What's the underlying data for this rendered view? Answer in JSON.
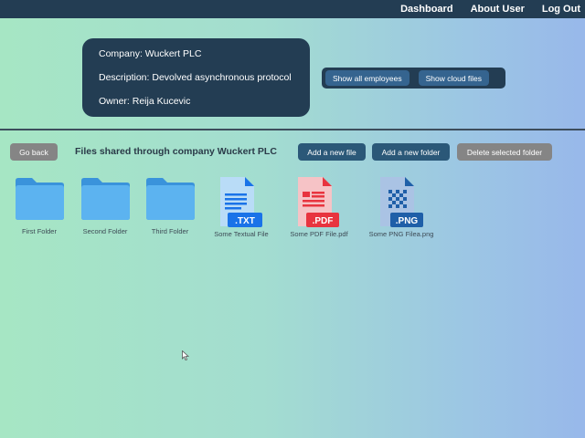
{
  "nav": {
    "dashboard": "Dashboard",
    "about_user": "About User",
    "logout": "Log Out"
  },
  "company_card": {
    "company": "Company: Wuckert PLC",
    "description": "Description: Devolved asynchronous protocol",
    "owner": "Owner: Reija Kucevic"
  },
  "company_actions": {
    "show_employees": "Show all employees",
    "show_cloud_files": "Show cloud files"
  },
  "toolbar": {
    "go_back": "Go back",
    "title": "Files shared through company Wuckert PLC",
    "add_file": "Add a new file",
    "add_folder": "Add a new folder",
    "delete_folder": "Delete selected folder"
  },
  "items": [
    {
      "type": "folder",
      "name": "First Folder",
      "icon": "folder-icon"
    },
    {
      "type": "folder",
      "name": "Second Folder",
      "icon": "folder-icon"
    },
    {
      "type": "folder",
      "name": "Third Folder",
      "icon": "folder-icon"
    },
    {
      "type": "file",
      "name": "Some Textual File",
      "badge": ".TXT",
      "icon": "txt-file-icon",
      "color": "#1a73e8"
    },
    {
      "type": "file",
      "name": "Some PDF File.pdf",
      "badge": ".PDF",
      "icon": "pdf-file-icon",
      "color": "#e8343f"
    },
    {
      "type": "file",
      "name": "Some PNG Filea.png",
      "badge": ".PNG",
      "icon": "png-file-icon",
      "color": "#1f5fa8"
    }
  ],
  "colors": {
    "navbar": "#233d53",
    "button_blue": "#2b5878",
    "button_gray": "#858585",
    "folder": "#4aa3e8"
  }
}
